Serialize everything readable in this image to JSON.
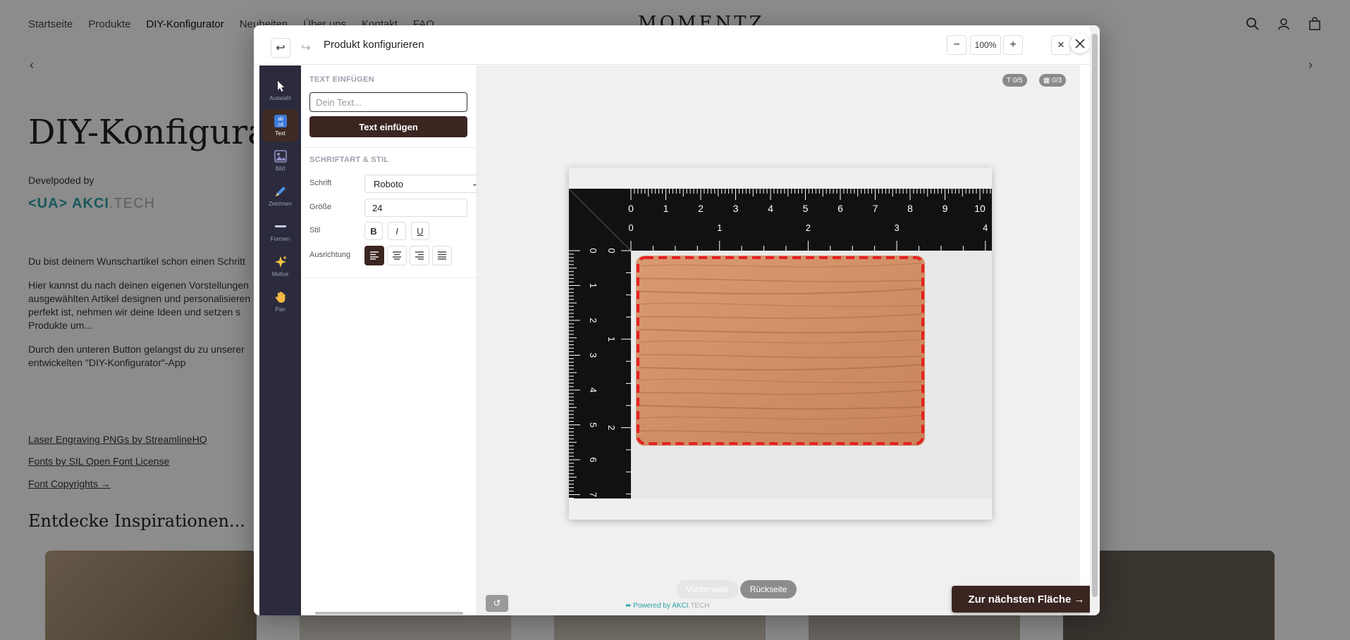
{
  "background": {
    "nav": [
      "Startseite",
      "Produkte",
      "DIY-Konfigurator",
      "Neuheiten",
      "Über uns",
      "Kontakt",
      "FAQ"
    ],
    "logo": "MOMENTZ",
    "title": "DIY-Konfigurator",
    "developed_by": "Develpoded by",
    "dev_logo_main": "<UA> AKCI",
    "dev_logo_suffix": ".TECH",
    "para1": "Du bist deinem Wunschartikel schon einen Schritt",
    "para2a": "Hier kannst du nach deinen eigenen Vorstellungen",
    "para2b": "ausgewählten Artikel designen und personalisieren",
    "para2c": "perfekt ist, nehmen wir deine Ideen und setzen s",
    "para2d": "Produkte um...",
    "para3a": "Durch den unteren Button gelangst du zu unserer",
    "para3b": "entwickelten \"DIY-Konfigurator\"-App",
    "link1": "Laser Engraving PNGs by StreamlineHQ",
    "link2": "Fonts by SIL Open Font License",
    "link3": "Font Copyrights →",
    "inspiration": "Entdecke Inspirationen..."
  },
  "modal": {
    "title": "Produkt konfigurieren",
    "undo_icon": "↩",
    "redo_icon": "↪",
    "zoom_out": "−",
    "zoom_value": "100%",
    "zoom_in": "+",
    "reset_zoom_icon": "✕"
  },
  "tools": [
    {
      "label": "Auswahl",
      "icon": "cursor-icon"
    },
    {
      "label": "Text",
      "icon": "text-icon"
    },
    {
      "label": "Bild",
      "icon": "image-icon"
    },
    {
      "label": "Zeichnen",
      "icon": "pen-icon"
    },
    {
      "label": "Formen",
      "icon": "shapes-icon"
    },
    {
      "label": "Motive",
      "icon": "sparkles-icon"
    },
    {
      "label": "Pan",
      "icon": "hand-icon"
    }
  ],
  "panel": {
    "insert_title": "TEXT EINFÜGEN",
    "text_placeholder": "Dein Text...",
    "insert_button": "Text einfügen",
    "style_title": "SCHRIFTART & STIL",
    "font_label": "Schrift",
    "font_value": "Roboto",
    "size_label": "Größe",
    "size_value": "24",
    "style_label": "Stil",
    "bold": "B",
    "italic": "I",
    "underline": "U",
    "align_label": "Ausrichtung"
  },
  "canvas": {
    "text_counter": "T 0/5",
    "image_counter": "▦ 0/3",
    "front_label": "Vorderseite",
    "back_label": "Rückseite",
    "reset_icon": "↺",
    "powered_prefix": "⬌ Powered by AKCI",
    "powered_suffix": ".TECH",
    "next_button": "Zur nächsten Fläche →",
    "ruler_top_cm": [
      "0",
      "1",
      "2",
      "3",
      "4",
      "5",
      "6",
      "7",
      "8",
      "9",
      "10"
    ],
    "ruler_top_in": [
      "0",
      "1",
      "2",
      "3",
      "4"
    ],
    "ruler_left_cm": [
      "0",
      "1",
      "2",
      "3",
      "4",
      "5",
      "6",
      "7"
    ],
    "ruler_left_in": [
      "0",
      "1",
      "2"
    ]
  },
  "colors": {
    "brand_dark": "#3b2521",
    "toolbar_bg": "#2b2b3d",
    "accent_teal": "#2aa3a8",
    "cut_line": "#e52222",
    "wood": "#d28f66"
  }
}
